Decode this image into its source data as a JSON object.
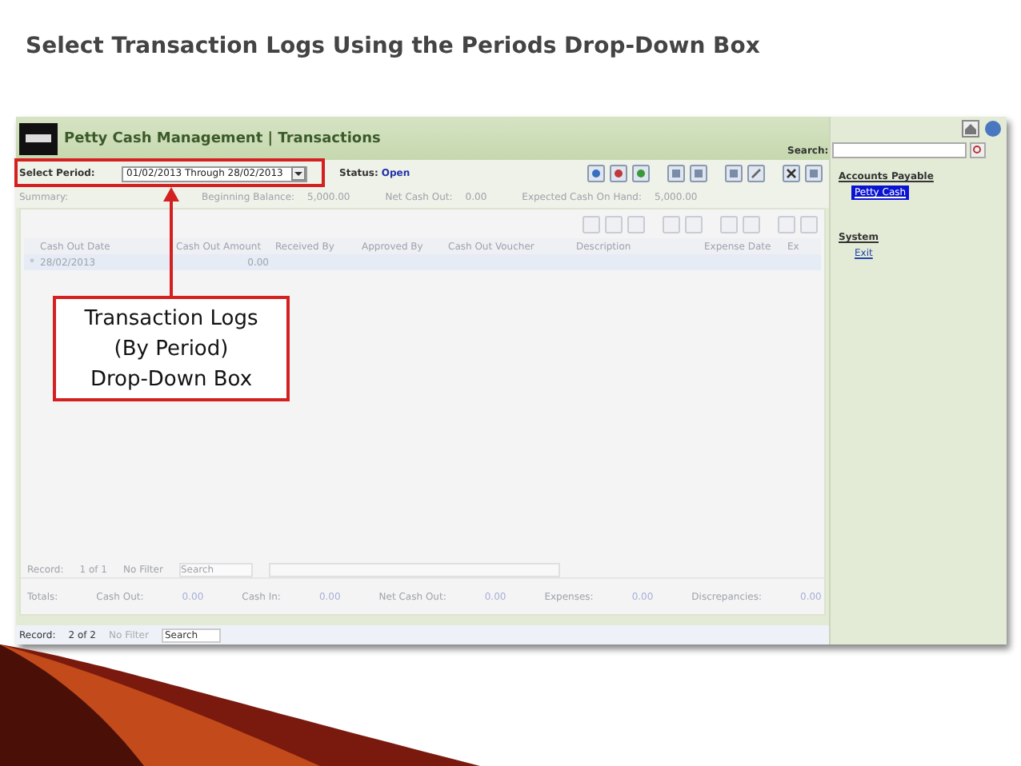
{
  "slide_title": "Select Transaction Logs Using the Periods Drop-Down Box",
  "window": {
    "title": "Petty Cash Management | Transactions",
    "search_label": "Search:"
  },
  "period": {
    "label": "Select Period:",
    "value": "01/02/2013 Through 28/02/2013",
    "status_label": "Status:",
    "status": "Open"
  },
  "summary": {
    "label": "Summary:",
    "fields": [
      {
        "label": "Beginning Balance:",
        "value": "5,000.00"
      },
      {
        "label": "Net Cash Out:",
        "value": "0.00"
      },
      {
        "label": "Expected Cash On Hand:",
        "value": "5,000.00"
      }
    ]
  },
  "table": {
    "columns": [
      "Cash Out Date",
      "Cash Out Amount",
      "Received By",
      "Approved By",
      "Cash Out Voucher",
      "Description",
      "Expense Date",
      "Ex"
    ],
    "row_marker": "*",
    "rows": [
      [
        "28/02/2013",
        "0.00",
        "",
        "",
        "",
        "",
        "",
        ""
      ]
    ]
  },
  "inner_nav": {
    "label": "Record:",
    "position": "1 of 1",
    "filter": "No Filter",
    "search": "Search"
  },
  "totals": {
    "label": "Totals:",
    "fields": [
      {
        "label": "Cash Out:",
        "value": "0.00"
      },
      {
        "label": "Cash In:",
        "value": "0.00"
      },
      {
        "label": "Net Cash Out:",
        "value": "0.00"
      },
      {
        "label": "Expenses:",
        "value": "0.00"
      },
      {
        "label": "Discrepancies:",
        "value": "0.00"
      }
    ]
  },
  "nav": {
    "label": "Record:",
    "position": "2 of 2",
    "filter": "No Filter",
    "search": "Search"
  },
  "sidebar": {
    "groups": [
      {
        "title": "Accounts Payable",
        "items": [
          {
            "label": "Petty Cash",
            "selected": true
          }
        ]
      },
      {
        "title": "System",
        "items": [
          {
            "label": "Exit",
            "selected": false
          }
        ]
      }
    ]
  },
  "callout": {
    "text": "Transaction Logs\n(By Period)\nDrop-Down Box"
  }
}
